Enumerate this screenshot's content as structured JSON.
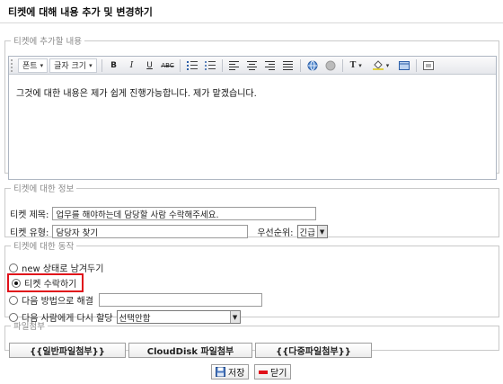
{
  "page": {
    "title": "티켓에 대해 내용 추가 및 변경하기"
  },
  "content_section": {
    "legend": "티켓에 추가할 내용",
    "toolbar": {
      "font_label": "폰트",
      "size_label": "글자 크기",
      "bold": "B",
      "italic": "I",
      "underline": "U",
      "strike": "ABC",
      "text_color_label": "T"
    },
    "body": "그것에 대한 내용은 제가 쉽게 진행가능합니다. 제가 맡겠습니다."
  },
  "info_section": {
    "legend": "티켓에 대한 정보",
    "subject_label": "티켓 제목:",
    "subject_value": "업무를 해야하는데 담당할 사람 수락해주세요.",
    "type_label": "티켓 유형:",
    "type_value": "담당자 찾기",
    "priority_label": "우선순위:",
    "priority_value": "긴급"
  },
  "action_section": {
    "legend": "티켓에 대한 동작",
    "options": [
      {
        "label": "new 상태로 남겨두기",
        "selected": false
      },
      {
        "label": "티켓 수락하기",
        "selected": true
      },
      {
        "label": "다음 방법으로 해결",
        "selected": false
      },
      {
        "label": "다음 사람에게 다시 할당",
        "selected": false
      }
    ],
    "reassign_value": "선택안함"
  },
  "attach_section": {
    "legend": "파일첨부",
    "normal_button": "{{일반파일첨부}}",
    "clouddisk_button": "CloudDisk 파일첨부",
    "multi_button": "{{다중파일첨부}}"
  },
  "actions": {
    "save_label": "저장",
    "close_label": "닫기"
  },
  "colors": {
    "highlight": "#e0101a",
    "accent_blue": "#2d5fa8"
  }
}
